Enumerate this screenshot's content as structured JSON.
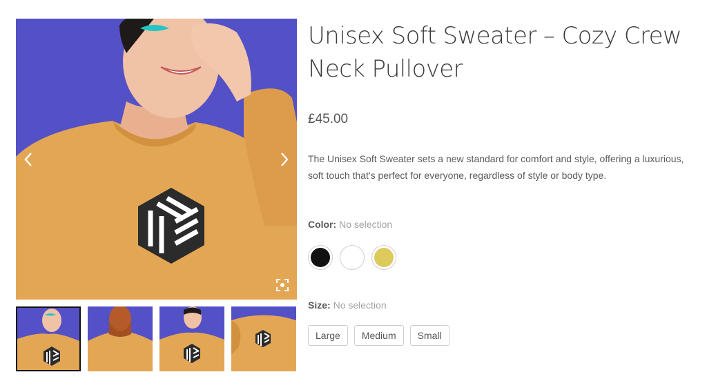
{
  "product": {
    "title": "Unisex Soft Sweater – Cozy Crew Neck Pullover",
    "price": "£45.00",
    "description": "The Unisex Soft Sweater sets a new standard for comfort and style, offering a luxurious, soft touch that's perfect for everyone, regardless of style or body type."
  },
  "gallery": {
    "main_image": "woman-in-mustard-sweater-photo",
    "prev_icon": "chevron-left-icon",
    "next_icon": "chevron-right-icon",
    "zoom_icon": "zoom-icon",
    "thumbnails": [
      {
        "name": "front-smiling",
        "active": true
      },
      {
        "name": "back-view",
        "active": false
      },
      {
        "name": "front-hand-hair",
        "active": false
      },
      {
        "name": "flat-lay",
        "active": false
      }
    ]
  },
  "color": {
    "label": "Color:",
    "selection": "No selection",
    "options": [
      {
        "name": "black",
        "hex": "#111111"
      },
      {
        "name": "white",
        "hex": "#ffffff"
      },
      {
        "name": "yellow",
        "hex": "#dccb5c"
      }
    ]
  },
  "size": {
    "label": "Size:",
    "selection": "No selection",
    "options": [
      "Large",
      "Medium",
      "Small"
    ]
  },
  "colors": {
    "background_blue": "#5450c6",
    "sweater": "#e3a655"
  }
}
